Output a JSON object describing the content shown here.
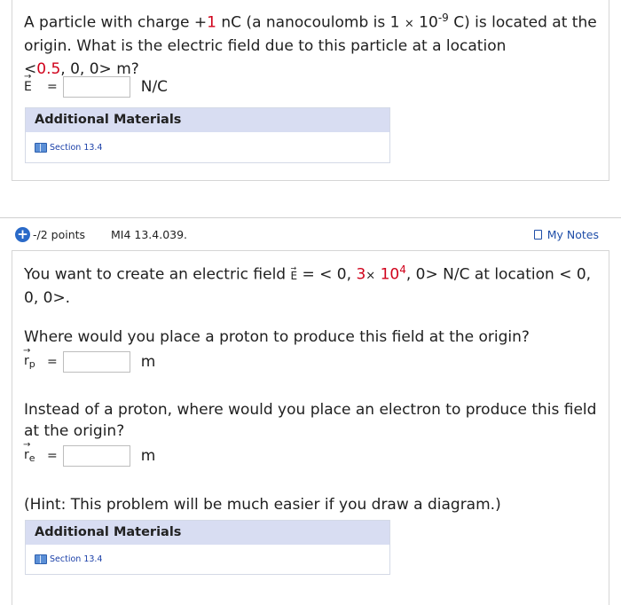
{
  "q1": {
    "text_a": "A particle with charge +",
    "charge": "1",
    "text_b": " nC (a nanocoulomb is 1 ",
    "times": "×",
    "text_c": " 10",
    "exp": "-9",
    "text_d": " C) is located at the origin. What is the electric field due to this particle at a location",
    "loc_open": "<",
    "loc_x": "0.5",
    "loc_rest": ", 0, 0> m?",
    "answer": {
      "label": "E",
      "equals": "=",
      "unit": "N/C",
      "value": ""
    },
    "materials": {
      "heading": "Additional Materials",
      "link": "Section 13.4"
    }
  },
  "q2": {
    "points": "-/2 points",
    "id": "MI4 13.4.039.",
    "my_notes": "My Notes",
    "intro_a": "You want to create an electric field ",
    "field_sym": "E",
    "intro_b": " = < 0, ",
    "field_coef": "3",
    "times": "×",
    "field_base": " 10",
    "field_exp": "4",
    "intro_c": ", 0> N/C at location < 0, 0, 0>.",
    "proton_q": "Where would you place a proton to produce this field at the origin?",
    "proton_answer": {
      "label": "r",
      "sub": "p",
      "equals": "=",
      "unit": "m",
      "value": ""
    },
    "electron_q": "Instead of a proton, where would you place an electron to produce this field at the origin?",
    "electron_answer": {
      "label": "r",
      "sub": "e",
      "equals": "=",
      "unit": "m",
      "value": ""
    },
    "hint": "(Hint: This problem will be much easier if you draw a diagram.)",
    "materials": {
      "heading": "Additional Materials",
      "link": "Section 13.4"
    }
  },
  "colors": {
    "accent_red": "#d0021b",
    "link_blue": "#1f4ea8",
    "materials_header": "#d8ddf2"
  }
}
